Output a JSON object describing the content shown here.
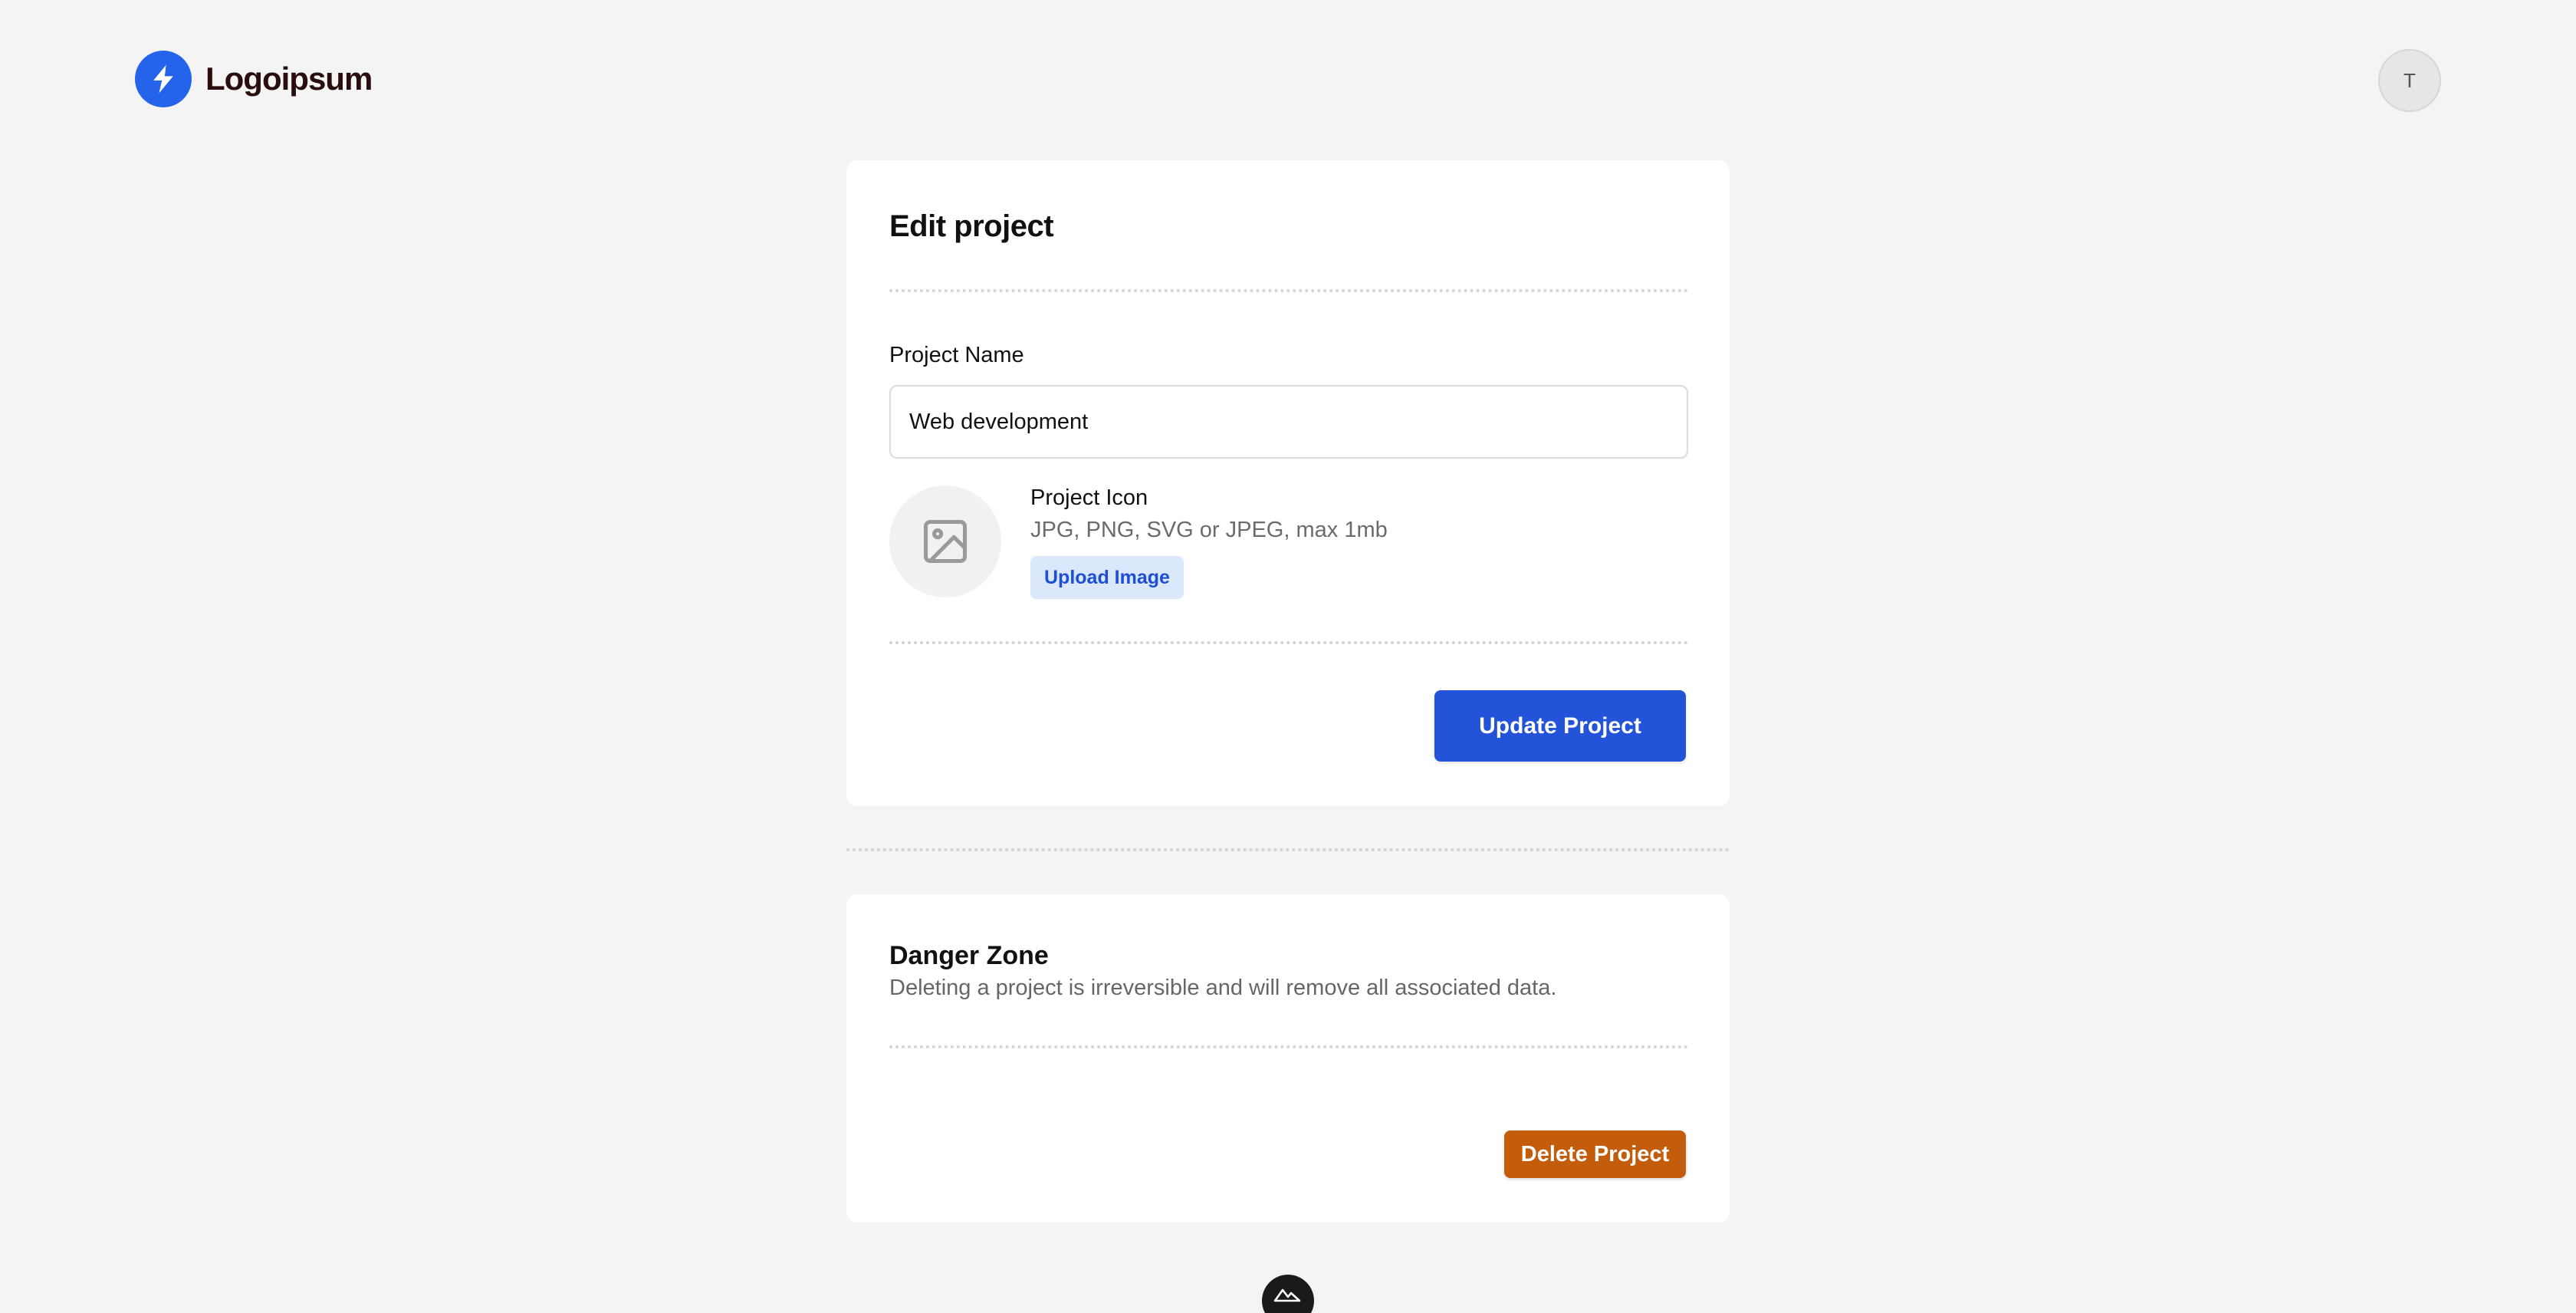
{
  "header": {
    "logo_text": "Logoipsum",
    "logo_icon": "lightning-bolt-icon",
    "avatar_initial": "T"
  },
  "edit_card": {
    "title": "Edit project",
    "project_name_label": "Project Name",
    "project_name_value": "Web development",
    "project_icon_label": "Project Icon",
    "project_icon_hint": "JPG, PNG, SVG or JPEG, max 1mb",
    "upload_button_label": "Upload Image",
    "update_button_label": "Update Project"
  },
  "danger_card": {
    "title": "Danger Zone",
    "description": "Deleting a project is irreversible and will remove all associated data.",
    "delete_button_label": "Delete Project"
  },
  "colors": {
    "background": "#f4f4f4",
    "primary": "#2253d8",
    "danger": "#c35d0c",
    "upload_bg": "#dbe8fb"
  }
}
